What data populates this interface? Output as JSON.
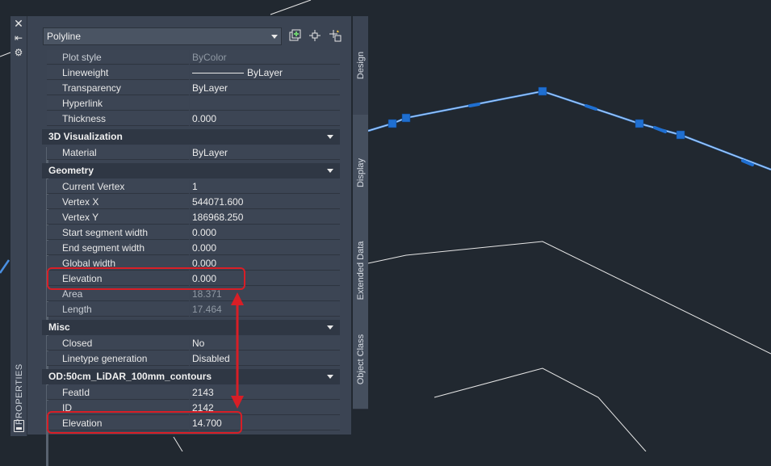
{
  "palette": {
    "title": "PROPERTIES",
    "selected_type": "Polyline",
    "toolbar_icons": [
      "toggle-pickadd-icon",
      "select-objects-icon",
      "quick-select-icon"
    ],
    "side_icons": [
      "close-icon",
      "auto-hide-icon",
      "palette-settings-icon"
    ]
  },
  "rows_general": [
    {
      "label": "Plot style",
      "value": "ByColor",
      "dim": true
    },
    {
      "label": "Lineweight",
      "value": "ByLayer"
    },
    {
      "label": "Transparency",
      "value": "ByLayer"
    },
    {
      "label": "Hyperlink",
      "value": ""
    },
    {
      "label": "Thickness",
      "value": "0.000"
    }
  ],
  "cat_3d": {
    "title": "3D Visualization"
  },
  "rows_3d": [
    {
      "label": "Material",
      "value": "ByLayer"
    }
  ],
  "cat_geometry": {
    "title": "Geometry"
  },
  "rows_geometry": [
    {
      "label": "Current Vertex",
      "value": "1"
    },
    {
      "label": "Vertex X",
      "value": "544071.600"
    },
    {
      "label": "Vertex Y",
      "value": "186968.250"
    },
    {
      "label": "Start segment width",
      "value": "0.000"
    },
    {
      "label": "End segment width",
      "value": "0.000"
    },
    {
      "label": "Global width",
      "value": "0.000"
    },
    {
      "label": "Elevation",
      "value": "0.000"
    },
    {
      "label": "Area",
      "value": "18.371",
      "dim": true
    },
    {
      "label": "Length",
      "value": "17.464",
      "dim": true
    }
  ],
  "cat_misc": {
    "title": "Misc"
  },
  "rows_misc": [
    {
      "label": "Closed",
      "value": "No"
    },
    {
      "label": "Linetype generation",
      "value": "Disabled"
    }
  ],
  "cat_od": {
    "title": "OD:50cm_LiDAR_100mm_contours"
  },
  "rows_od": [
    {
      "label": "FeatId",
      "value": "2143"
    },
    {
      "label": "ID",
      "value": "2142"
    },
    {
      "label": "Elevation",
      "value": "14.700"
    }
  ],
  "side_tabs": [
    "Design",
    "Display",
    "Extended Data",
    "Object Class"
  ],
  "colors": {
    "canvas": "#212830",
    "palette": "#3b4453",
    "highlight": "#d81e26",
    "selected_polyline": "#4a90e2",
    "grip": "#1f6fd1",
    "contour_lines": "#e6e6e6"
  }
}
